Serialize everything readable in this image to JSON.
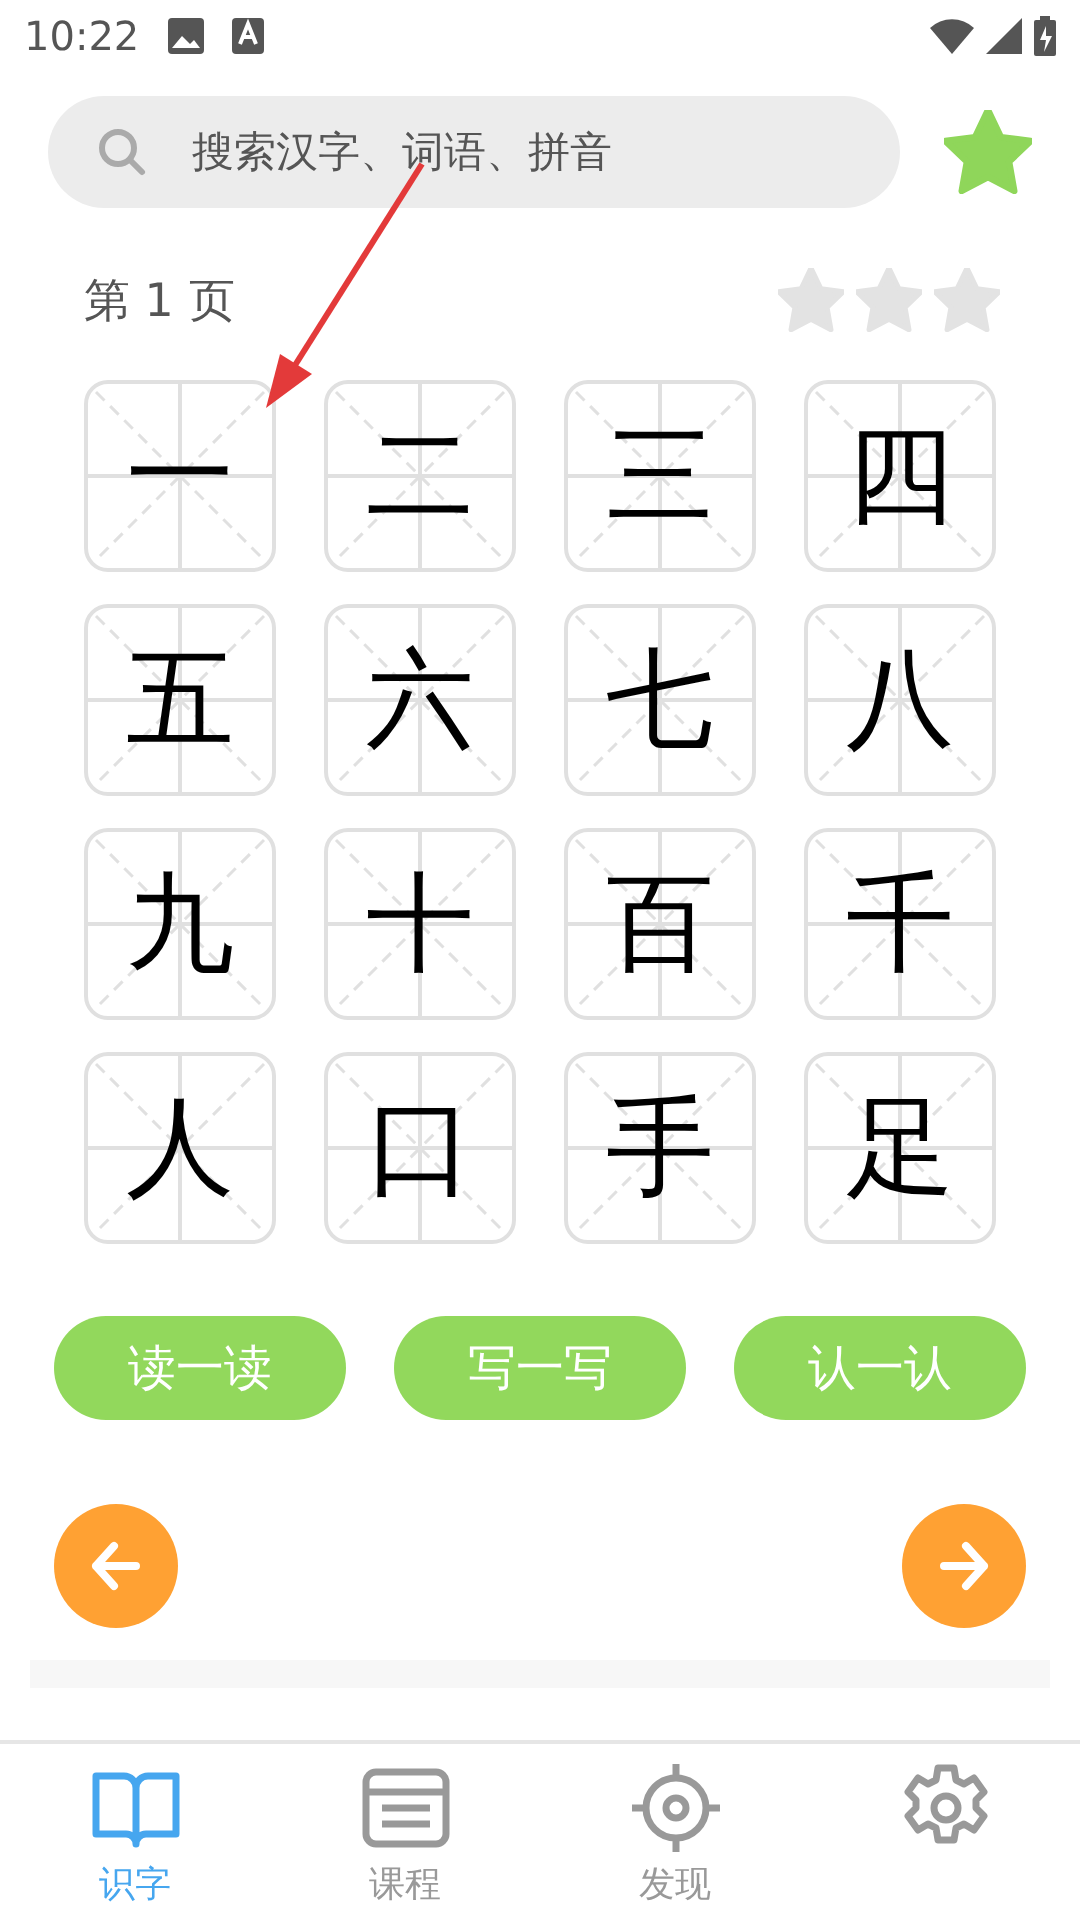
{
  "status_bar": {
    "time": "10:22"
  },
  "search": {
    "placeholder": "搜索汉字、词语、拼音"
  },
  "page": {
    "label": "第 1 页",
    "stars": 0
  },
  "characters": [
    "一",
    "二",
    "三",
    "四",
    "五",
    "六",
    "七",
    "八",
    "九",
    "十",
    "百",
    "千",
    "人",
    "口",
    "手",
    "足"
  ],
  "actions": [
    "读一读",
    "写一写",
    "认一认"
  ],
  "tabs": [
    {
      "label": "识字",
      "selected": true
    },
    {
      "label": "课程",
      "selected": false
    },
    {
      "label": "发现",
      "selected": false
    },
    {
      "selected": false
    }
  ]
}
